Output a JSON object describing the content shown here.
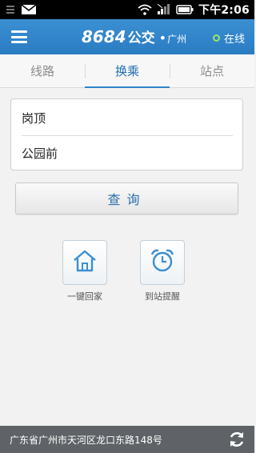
{
  "status_bar": {
    "time": "下午2:06",
    "left_icons": [
      "notification-icon",
      "mail-icon"
    ],
    "right_icons": [
      "wifi-icon",
      "signal-icon",
      "battery-icon"
    ]
  },
  "header": {
    "brand_number": "8684",
    "brand_name": "公交",
    "brand_dot": "•",
    "city": "广州",
    "online_label": "在线",
    "accent_color": "#2f83c9",
    "online_color": "#9ee26a"
  },
  "tabs": [
    {
      "label": "线路",
      "active": false
    },
    {
      "label": "换乘",
      "active": true
    },
    {
      "label": "站点",
      "active": false
    }
  ],
  "route": {
    "start": "岗顶",
    "end": "公园前"
  },
  "query_button": {
    "label": "查询"
  },
  "quick_actions": [
    {
      "label": "一键回家",
      "icon": "home-icon"
    },
    {
      "label": "到站提醒",
      "icon": "alarm-clock-icon"
    }
  ],
  "footer": {
    "location": "广东省广州市天河区龙口东路148号",
    "refresh_icon": "refresh-icon"
  }
}
